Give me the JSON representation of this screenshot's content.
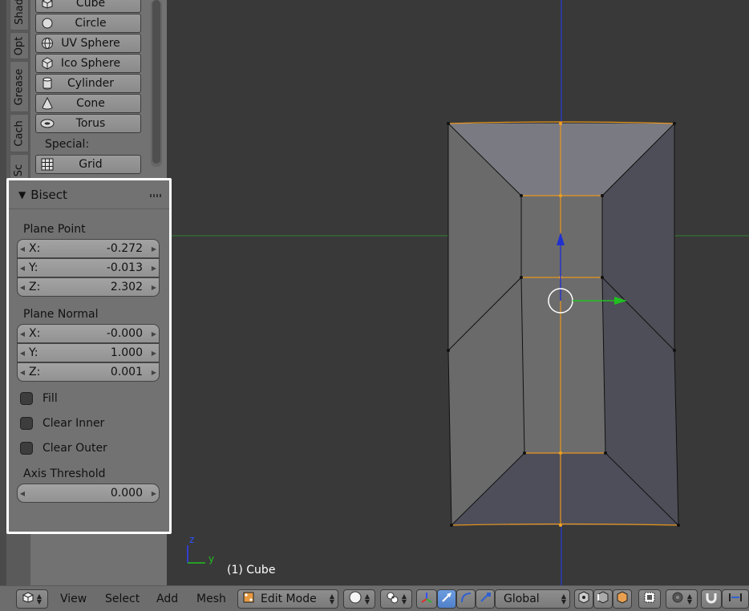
{
  "tool_shelf": {
    "tabs": [
      "Shad",
      "Opt",
      "Grease",
      "Cach",
      "Sc"
    ],
    "create_items": [
      {
        "label": "Cube",
        "icon": "cube-icon"
      },
      {
        "label": "Circle",
        "icon": "circle-icon"
      },
      {
        "label": "UV Sphere",
        "icon": "uv-sphere-icon"
      },
      {
        "label": "Ico Sphere",
        "icon": "ico-sphere-icon"
      },
      {
        "label": "Cylinder",
        "icon": "cylinder-icon"
      },
      {
        "label": "Cone",
        "icon": "cone-icon"
      },
      {
        "label": "Torus",
        "icon": "torus-icon"
      }
    ],
    "special_label": "Special:",
    "special_items": [
      {
        "label": "Grid",
        "icon": "grid-icon"
      }
    ]
  },
  "redo_panel": {
    "title": "Bisect",
    "plane_point": {
      "label": "Plane Point",
      "x": {
        "axis": "X:",
        "value": "-0.272"
      },
      "y": {
        "axis": "Y:",
        "value": "-0.013"
      },
      "z": {
        "axis": "Z:",
        "value": "2.302"
      }
    },
    "plane_normal": {
      "label": "Plane Normal",
      "x": {
        "axis": "X:",
        "value": "-0.000"
      },
      "y": {
        "axis": "Y:",
        "value": "1.000"
      },
      "z": {
        "axis": "Z:",
        "value": "0.001"
      }
    },
    "fill": {
      "label": "Fill",
      "checked": false
    },
    "clear_inner": {
      "label": "Clear Inner",
      "checked": false
    },
    "clear_outer": {
      "label": "Clear Outer",
      "checked": false
    },
    "axis_threshold": {
      "label": "Axis Threshold",
      "value": "0.000"
    }
  },
  "viewport": {
    "object_label": "(1) Cube",
    "axis_z": "z",
    "axis_y": "y"
  },
  "header": {
    "menus": [
      "View",
      "Select",
      "Add",
      "Mesh"
    ],
    "mode": "Edit Mode",
    "orientation": "Global"
  },
  "colors": {
    "selected_edge": "#f0a020",
    "x_axis_line": "#2a7a2a",
    "z_axis_line": "#2233aa",
    "face_light": "#7d7d85",
    "face_dark": "#585860"
  }
}
